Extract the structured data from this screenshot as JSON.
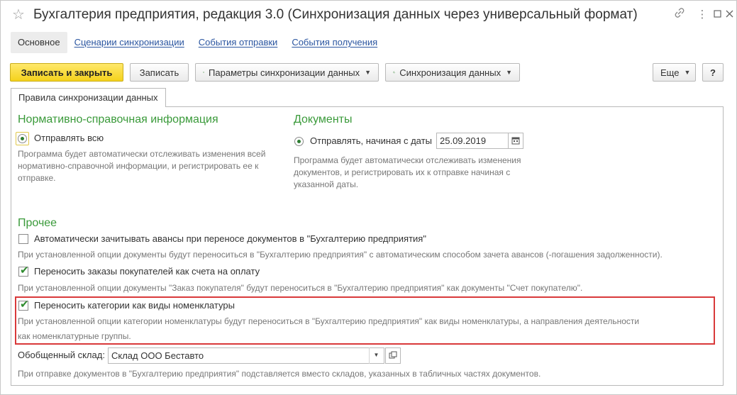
{
  "window": {
    "title": "Бухгалтерия предприятия, редакция 3.0 (Синхронизация данных через универсальный формат)"
  },
  "nav": {
    "tabs": [
      "Основное",
      "Сценарии синхронизации",
      "События отправки",
      "События получения"
    ]
  },
  "toolbar": {
    "save_close": "Записать и закрыть",
    "save": "Записать",
    "sync_params": "Параметры синхронизации данных",
    "sync_data": "Синхронизация данных",
    "more": "Еще",
    "help": "?"
  },
  "tab": {
    "label": "Правила синхронизации данных"
  },
  "reference": {
    "title": "Нормативно-справочная информация",
    "option": "Отправлять всю",
    "hint1": "Программа будет автоматически отслеживать изменения всей",
    "hint2": "нормативно-справочной информации, и регистрировать ее к",
    "hint3": "отправке."
  },
  "documents": {
    "title": "Документы",
    "option": "Отправлять, начиная с даты",
    "date": "25.09.2019",
    "hint1": "Программа будет автоматически отслеживать изменения",
    "hint2": "документов, и регистрировать их к отправке начиная с",
    "hint3": "указанной даты."
  },
  "other": {
    "title": "Прочее",
    "opt1_label": "Автоматически зачитывать авансы при переносе документов в \"Бухгалтерию предприятия\"",
    "opt1_checked": false,
    "opt1_hint": "При установленной опции документы будут переноситься в \"Бухгалтерию предприятия\" с автоматическим способом зачета авансов (-погашения задолженности).",
    "opt2_label": "Переносить заказы покупателей как счета на оплату",
    "opt2_checked": true,
    "opt2_hint": "При установленной опции документы \"Заказ покупателя\" будут переноситься в \"Бухгалтерию предприятия\" как документы \"Счет покупателю\".",
    "opt3_label": "Переносить категории как виды номенклатуры",
    "opt3_checked": true,
    "opt3_hint1": "При установленной опции категории номенклатуры будут переноситься в \"Бухгалтерию предприятия\" как виды номенклатуры, а направления деятельности",
    "opt3_hint2": "как номенклатурные группы.",
    "warehouse_label": "Обобщенный склад:",
    "warehouse_value": "Склад ООО Беставто",
    "warehouse_hint": "При отправке документов в \"Бухгалтерию предприятия\" подставляется вместо складов, указанных в табличных частях документов."
  },
  "colors": {
    "section_title": "#3a9a3a",
    "link": "#2a55a0",
    "primary_button": "#f4d21c",
    "highlight": "#d9393a"
  }
}
